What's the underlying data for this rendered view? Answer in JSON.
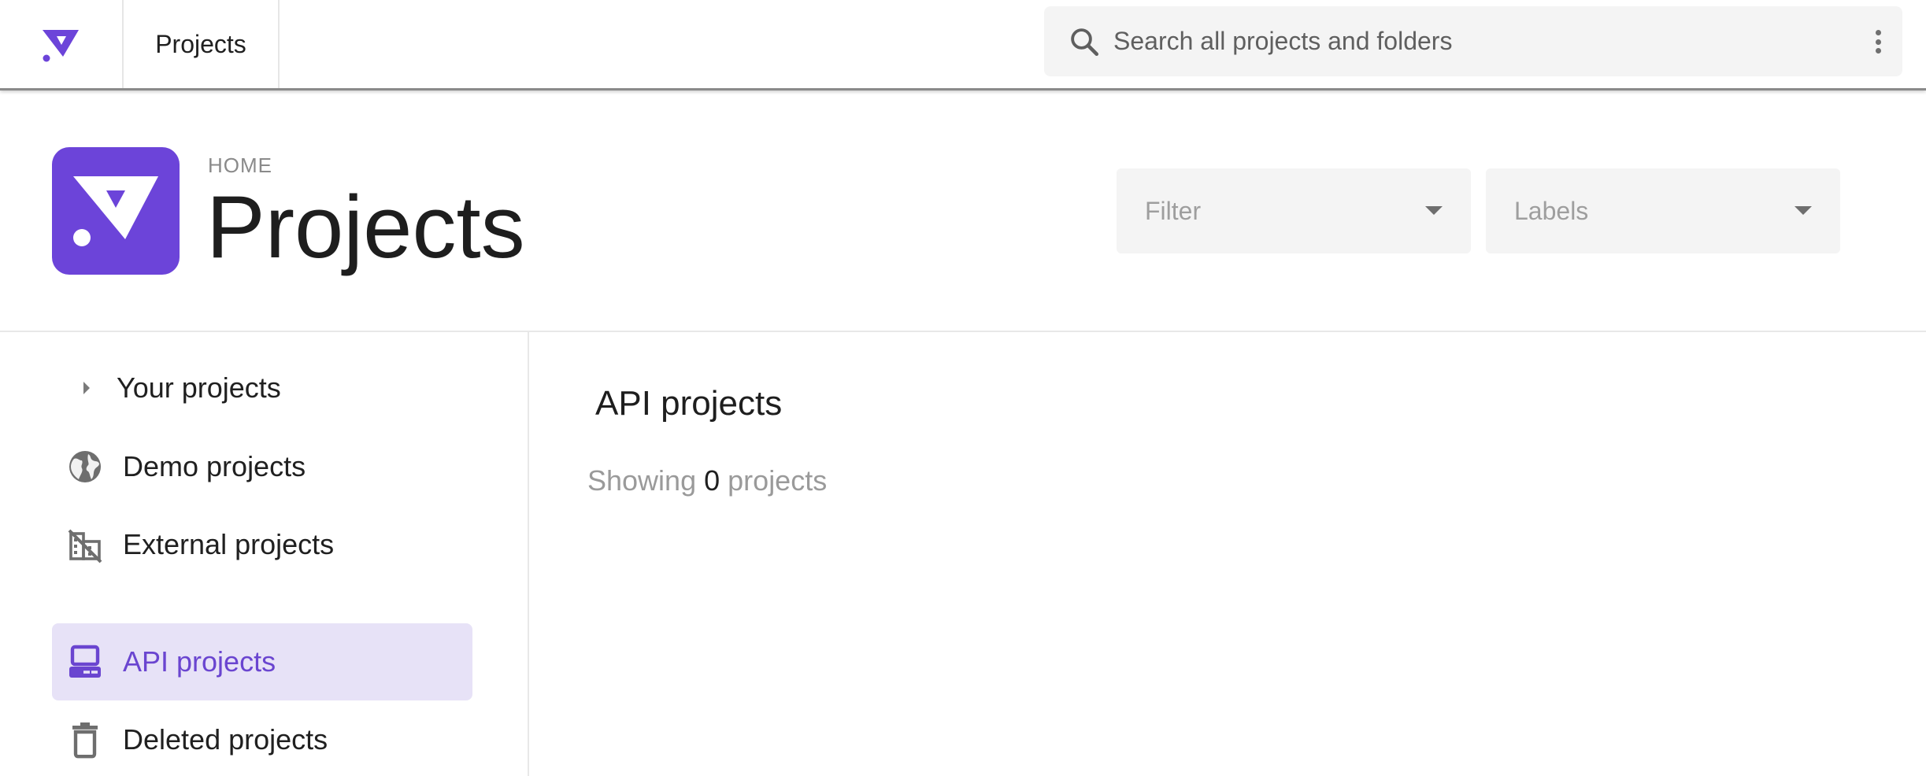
{
  "topbar": {
    "tab_label": "Projects",
    "search": {
      "placeholder": "Search all projects and folders",
      "value": ""
    }
  },
  "header": {
    "breadcrumb": "HOME",
    "title": "Projects",
    "filter_placeholder": "Filter",
    "labels_placeholder": "Labels"
  },
  "sidebar": {
    "items": [
      {
        "label": "Your projects",
        "icon": "chevron-right-icon",
        "active": false
      },
      {
        "label": "Demo projects",
        "icon": "globe-icon",
        "active": false
      },
      {
        "label": "External projects",
        "icon": "building-off-icon",
        "active": false
      },
      {
        "label": "API projects",
        "icon": "computer-icon",
        "active": true
      },
      {
        "label": "Deleted projects",
        "icon": "trash-icon",
        "active": false
      }
    ]
  },
  "main": {
    "section_title": "API projects",
    "count_prefix": "Showing",
    "count": "0",
    "count_suffix": "projects"
  },
  "colors": {
    "brand": "#6c44d9",
    "active_bg": "#e7e2f7",
    "active_text": "#6a45d0"
  }
}
